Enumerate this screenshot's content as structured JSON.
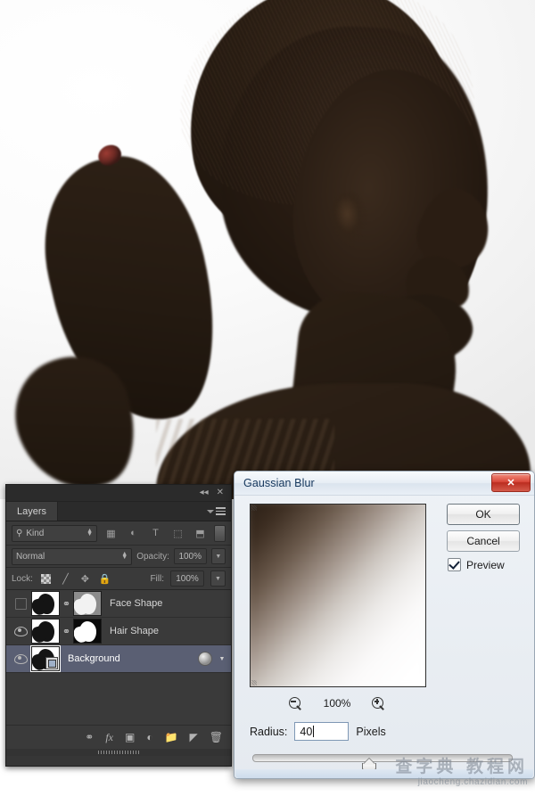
{
  "app": "Adobe Photoshop",
  "canvas": {
    "description": "Backlit profile silhouette photograph of a young woman with a ponytail against a white studio backdrop",
    "background_color": "#f7f7f7",
    "silhouette_color": "#241a12",
    "hairtie_color": "#8e3630"
  },
  "layers_panel": {
    "tab_label": "Layers",
    "topbar": {
      "collapse_icon": "double-chevron-left-icon",
      "collapse_glyph": "◂◂",
      "close_icon": "close-icon",
      "close_glyph": "✕"
    },
    "menu_icon": "panel-menu-icon",
    "filter_row": {
      "search_icon": "search-icon",
      "kind_label": "Kind",
      "icons": [
        {
          "name": "filter-pixel-layers-icon",
          "glyph": "⛰"
        },
        {
          "name": "filter-adjustment-layers-icon",
          "glyph": "◐"
        },
        {
          "name": "filter-type-layers-icon",
          "glyph": "T"
        },
        {
          "name": "filter-shape-layers-icon",
          "glyph": "⬚"
        },
        {
          "name": "filter-smart-objects-icon",
          "glyph": "⬒"
        }
      ],
      "toggle_name": "filter-enable-toggle"
    },
    "blend_row": {
      "blend_mode": "Normal",
      "opacity_label": "Opacity:",
      "opacity_value": "100%"
    },
    "lock_row": {
      "lock_label": "Lock:",
      "lock_icons": [
        {
          "name": "lock-transparent-pixels-icon",
          "glyph": ""
        },
        {
          "name": "lock-image-pixels-icon",
          "glyph": "╱"
        },
        {
          "name": "lock-position-icon",
          "glyph": "✥"
        },
        {
          "name": "lock-all-icon",
          "glyph": "🔒"
        }
      ],
      "fill_label": "Fill:",
      "fill_value": "100%"
    },
    "layers": [
      {
        "name": "Face Shape",
        "visible": false,
        "selected": false,
        "has_mask": true,
        "mask_type": "gray",
        "link_icon": "link-layers-icon"
      },
      {
        "name": "Hair Shape",
        "visible": true,
        "selected": false,
        "has_mask": true,
        "mask_type": "black",
        "link_icon": "link-layers-icon"
      },
      {
        "name": "Background",
        "visible": true,
        "selected": true,
        "has_mask": false,
        "smart_object": true,
        "fx_icon": "layer-effects-icon",
        "expand_icon": "chevron-down-icon"
      }
    ],
    "bottom_toolbar": [
      {
        "name": "link-layers-button",
        "glyph": "⚭"
      },
      {
        "name": "add-layer-style-button",
        "glyph": "fx"
      },
      {
        "name": "add-layer-mask-button",
        "glyph": "▣"
      },
      {
        "name": "new-fill-adjustment-layer-button",
        "glyph": "◐"
      },
      {
        "name": "new-group-button",
        "glyph": "▰"
      },
      {
        "name": "new-layer-button",
        "glyph": "◥"
      },
      {
        "name": "delete-layer-button",
        "glyph": "🗑"
      }
    ]
  },
  "gaussian_blur_dialog": {
    "title": "Gaussian Blur",
    "close_label": "✕",
    "ok_label": "OK",
    "cancel_label": "Cancel",
    "preview_label": "Preview",
    "preview_checked": true,
    "zoom_out_icon": "zoom-out-icon",
    "zoom_in_icon": "zoom-in-icon",
    "zoom_value": "100%",
    "radius_label": "Radius:",
    "radius_value": "40",
    "radius_units": "Pixels",
    "slider_position_percent": 45,
    "accent_color": "#d9483a"
  },
  "watermark": {
    "chinese": "查字典 教程网",
    "url": "jiaocheng.chazidian.com"
  }
}
